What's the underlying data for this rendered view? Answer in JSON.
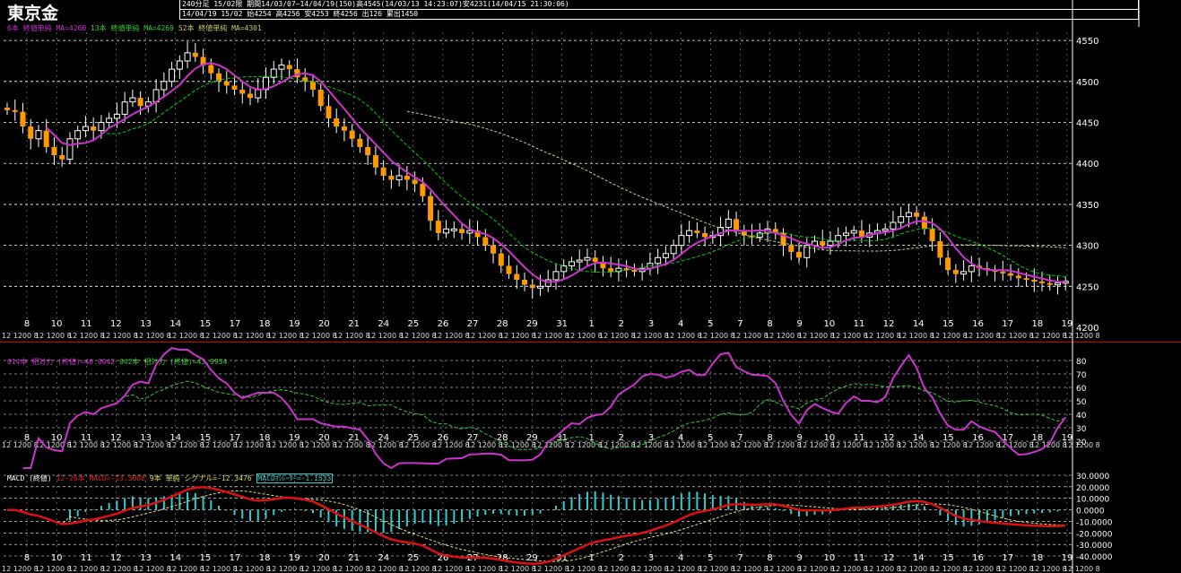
{
  "title": "東京金",
  "header": {
    "line1": "240分足 15/02限 期間14/03/07~14/04/19(150)高4545(14/03/13 14:23:07)安4231(14/04/15 21:30:06)",
    "line2": "14/04/19 15/02 始4254 高4256 安4253 終4256 出126 累出1450"
  },
  "colors": {
    "candle_up": "#ff9900",
    "candle_down": "#ff9900",
    "ma6": "#cc33cc",
    "ma13": "#00cc00",
    "ma52": "#cccc88",
    "rsi14": "#cc33cc",
    "rsi42": "#33cc33",
    "macd_line": "#dd1111",
    "macd_signal": "#dddd88",
    "macd_hist": "#33cccc",
    "separator": "#cc0000"
  },
  "legends": {
    "price": [
      {
        "text": "6本 終値単純 MA=4260",
        "color": "#cc33cc"
      },
      {
        "text": "13本 終値単純 MA=4269",
        "color": "#33cc33"
      },
      {
        "text": "52本 終値単純 MA=4301",
        "color": "#cccc66"
      }
    ],
    "rsi": [
      {
        "text": "014本 相対力 (終値)=40.0042",
        "color": "#cc33cc"
      },
      {
        "text": "042本 相対力 (終値)=43.9934",
        "color": "#33cc33"
      }
    ],
    "macd": [
      {
        "text": "MACD (終値)",
        "color": "#ffffff"
      },
      {
        "text": "12-26本 MACD=-13.5008",
        "color": "#dd2222"
      },
      {
        "text": "9本 単純 シグナル=-12.3476",
        "color": "#dddd66"
      },
      {
        "text": "MACDｵｼﾚｰﾀｰ=-1.1533",
        "color": "#33cccc"
      }
    ]
  },
  "chart_data": [
    {
      "type": "candlestick",
      "name": "price",
      "ylim": [
        4200,
        4560
      ],
      "yticks": [
        4200,
        4250,
        4300,
        4350,
        4400,
        4450,
        4500,
        4550
      ],
      "day_labels": [
        "8",
        "10",
        "11",
        "12",
        "13",
        "14",
        "15",
        "17",
        "18",
        "19",
        "20",
        "21",
        "24",
        "25",
        "26",
        "27",
        "28",
        "29",
        "31",
        "1",
        "2",
        "3",
        "4",
        "5",
        "7",
        "8",
        "9",
        "10",
        "11",
        "12",
        "14",
        "15",
        "16",
        "17",
        "18",
        "19"
      ],
      "session_labels": [
        "12",
        "1200",
        "8",
        "12",
        "1200"
      ],
      "closes": [
        4465,
        4463,
        4445,
        4430,
        4440,
        4420,
        4410,
        4405,
        4430,
        4440,
        4445,
        4440,
        4450,
        4455,
        4460,
        4475,
        4480,
        4470,
        4475,
        4490,
        4500,
        4515,
        4525,
        4535,
        4530,
        4520,
        4510,
        4500,
        4495,
        4490,
        4485,
        4480,
        4490,
        4505,
        4515,
        4520,
        4515,
        4505,
        4500,
        4490,
        4470,
        4455,
        4445,
        4440,
        4430,
        4420,
        4410,
        4395,
        4385,
        4380,
        4385,
        4380,
        4375,
        4360,
        4330,
        4315,
        4320,
        4320,
        4315,
        4318,
        4310,
        4300,
        4290,
        4275,
        4265,
        4258,
        4252,
        4248,
        4250,
        4258,
        4268,
        4275,
        4280,
        4282,
        4285,
        4280,
        4272,
        4268,
        4272,
        4270,
        4268,
        4272,
        4278,
        4285,
        4290,
        4300,
        4312,
        4318,
        4315,
        4310,
        4312,
        4322,
        4332,
        4318,
        4312,
        4310,
        4315,
        4320,
        4315,
        4300,
        4292,
        4285,
        4300,
        4305,
        4300,
        4305,
        4312,
        4315,
        4318,
        4310,
        4315,
        4318,
        4320,
        4328,
        4335,
        4340,
        4335,
        4320,
        4305,
        4285,
        4270,
        4265,
        4268,
        4275,
        4272,
        4270,
        4268,
        4266,
        4263,
        4260,
        4258,
        4256,
        4254,
        4252,
        4254,
        4256
      ],
      "ma6_last": 4260,
      "ma13_last": 4269,
      "ma52_last": 4301
    },
    {
      "type": "line",
      "name": "rsi",
      "ylim": [
        20,
        80
      ],
      "yticks": [
        20,
        30,
        40,
        50,
        60,
        70,
        80
      ],
      "series": [
        {
          "name": "014本 相対力 (終値)",
          "last": 40.0042
        },
        {
          "name": "042本 相対力 (終値)",
          "last": 43.9934
        }
      ]
    },
    {
      "type": "line",
      "name": "macd",
      "ylim": [
        -40,
        30
      ],
      "yticks": [
        "30.0000",
        "20.0000",
        "10.0000",
        "0.0000",
        "-10.0000",
        "-20.0000",
        "-30.0000",
        "-40.0000"
      ],
      "ytick_values": [
        30,
        20,
        10,
        0,
        -10,
        -20,
        -30,
        -40
      ],
      "series": [
        {
          "name": "12-26本 MACD",
          "last": -13.5008
        },
        {
          "name": "9本 単純 シグナル",
          "last": -12.3476
        },
        {
          "name": "MACDｵｼﾚｰﾀｰ",
          "last": -1.1533
        }
      ]
    }
  ]
}
